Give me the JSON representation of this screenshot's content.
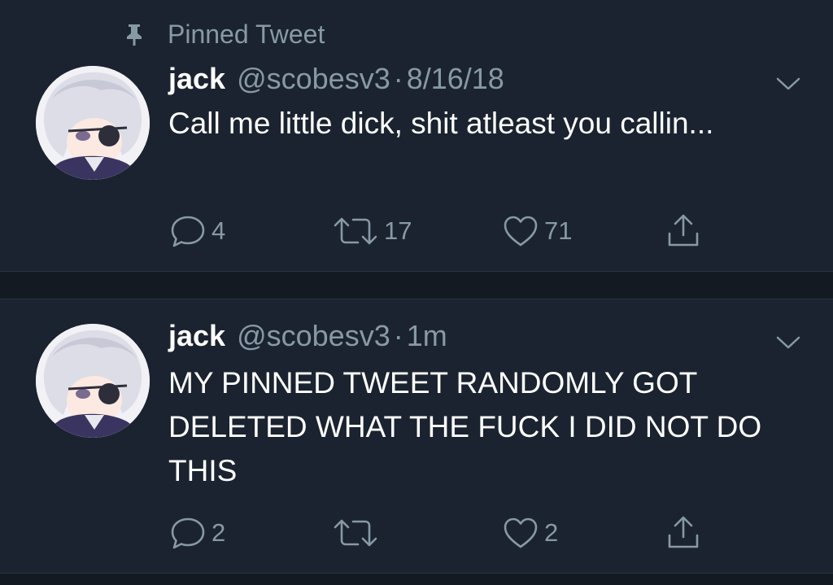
{
  "pinned_label": "Pinned Tweet",
  "colors": {
    "background": "#1b2330",
    "separator": "#141a22",
    "primary_text": "#ffffff",
    "secondary_text": "#8899a6"
  },
  "tweets": [
    {
      "name": "jack",
      "handle": "@scobesv3",
      "separator": "·",
      "time": "8/16/18",
      "text": "Call me little dick, shit atleast you callin...",
      "replies": "4",
      "retweets": "17",
      "likes": "71",
      "pinned": true
    },
    {
      "name": "jack",
      "handle": "@scobesv3",
      "separator": "·",
      "time": "1m",
      "text": "MY PINNED TWEET RANDOMLY GOT DELETED WHAT THE FUCK I DID NOT DO THIS",
      "replies": "2",
      "retweets": "",
      "likes": "2",
      "pinned": false
    }
  ],
  "icons": {
    "pin": "pin-icon",
    "caret": "chevron-down-icon",
    "reply": "reply-icon",
    "retweet": "retweet-icon",
    "like": "heart-icon",
    "share": "share-icon"
  }
}
